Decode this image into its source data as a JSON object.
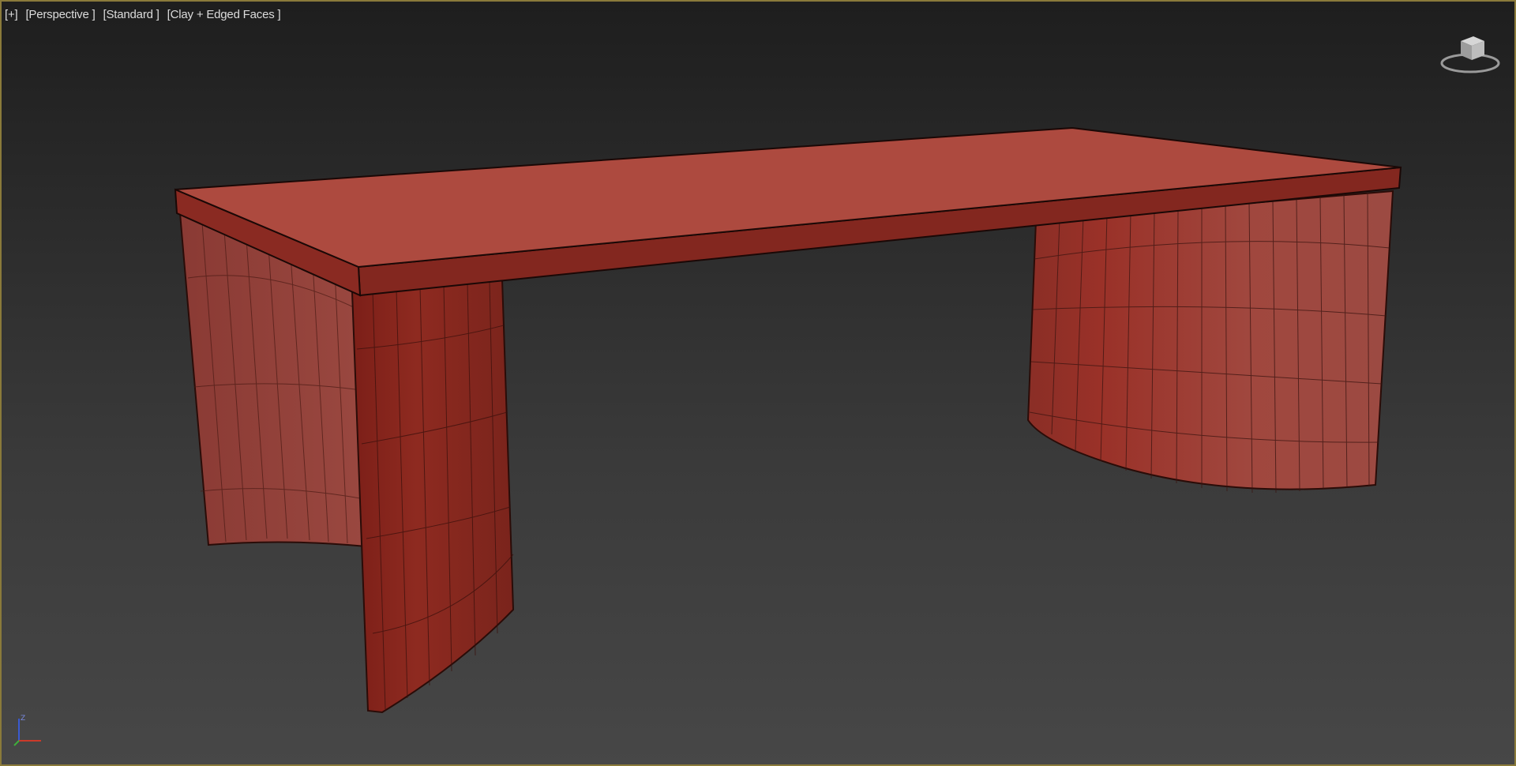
{
  "viewport": {
    "labels": {
      "plus": "[+]",
      "view": "[Perspective ]",
      "shading_preset": "[Standard ]",
      "display_mode": "[Clay + Edged Faces ]"
    },
    "border_color": "#8a7a3a",
    "object_color": "#b54a40"
  },
  "icons": {
    "viewcube": "viewcube-icon",
    "axis": "axis-tripod-icon"
  },
  "axis_tripod": {
    "z_label": "Z"
  }
}
